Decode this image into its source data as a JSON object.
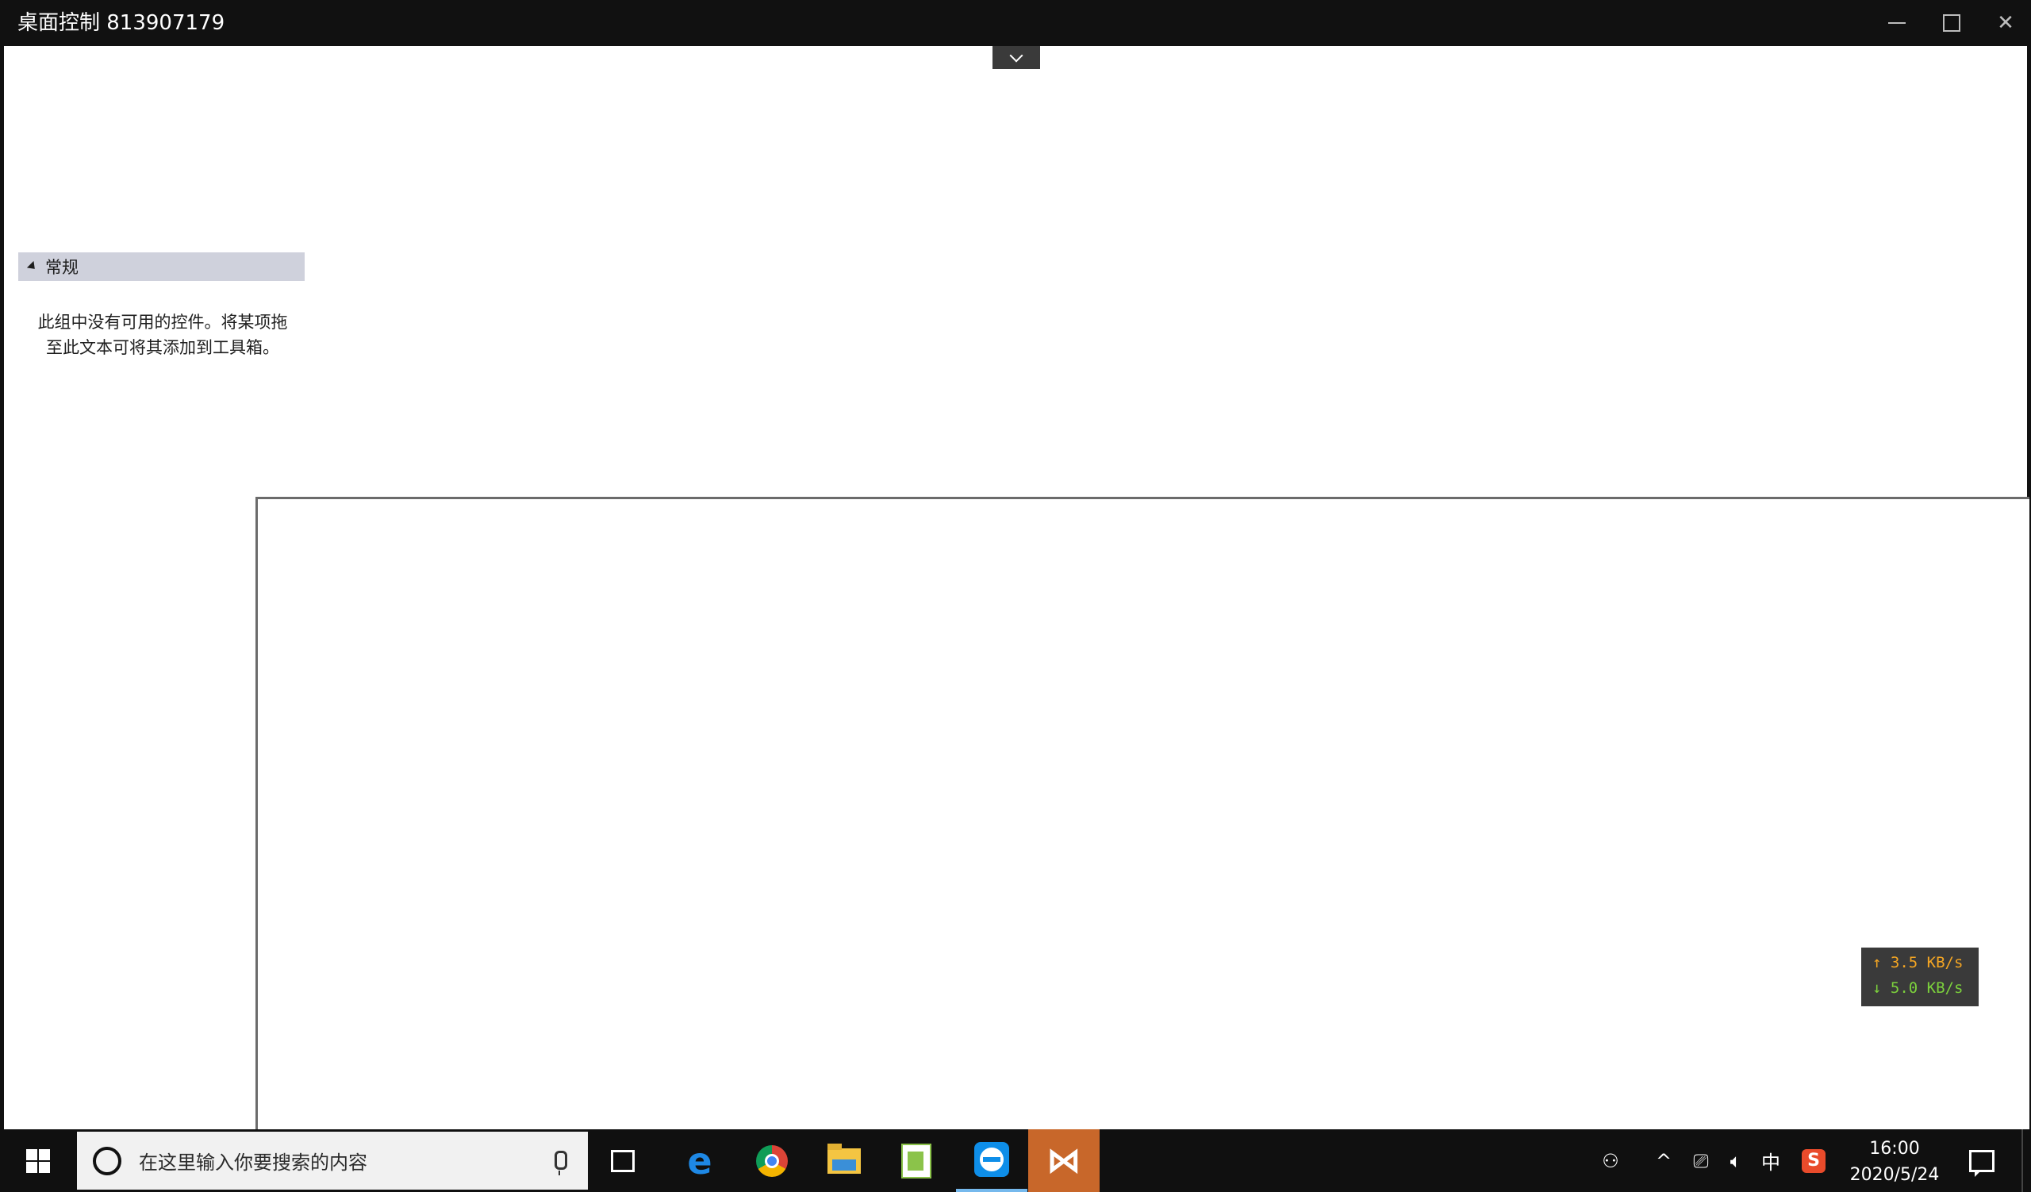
{
  "window": {
    "title": "桌面控制 813907179",
    "minimize_icon": "minimize-icon",
    "maximize_icon": "maximize-icon",
    "close_icon": "close-icon",
    "close_glyph": "✕"
  },
  "toolbox": {
    "group_label": "常规",
    "empty_message": "此组中没有可用的控件。将某项拖至此文本可将其添加到工具箱。"
  },
  "netspeed": {
    "upload": "↑ 3.5 KB/s",
    "download": "↓ 5.0 KB/s",
    "upload_color": "#f5a623",
    "download_color": "#7cd13c"
  },
  "taskbar": {
    "search_placeholder": "在这里输入你要搜索的内容",
    "apps": [
      {
        "name": "task-view",
        "icon": "task-view-icon"
      },
      {
        "name": "edge",
        "icon": "edge-icon"
      },
      {
        "name": "chrome",
        "icon": "chrome-icon"
      },
      {
        "name": "file-explorer",
        "icon": "folder-icon"
      },
      {
        "name": "editor",
        "icon": "editor-icon"
      },
      {
        "name": "teamviewer",
        "icon": "teamviewer-icon"
      },
      {
        "name": "visual-studio",
        "icon": "visual-studio-icon"
      }
    ],
    "tray": {
      "ime_label": "中",
      "sogou_label": "S",
      "time": "16:00",
      "date": "2020/5/24"
    }
  }
}
